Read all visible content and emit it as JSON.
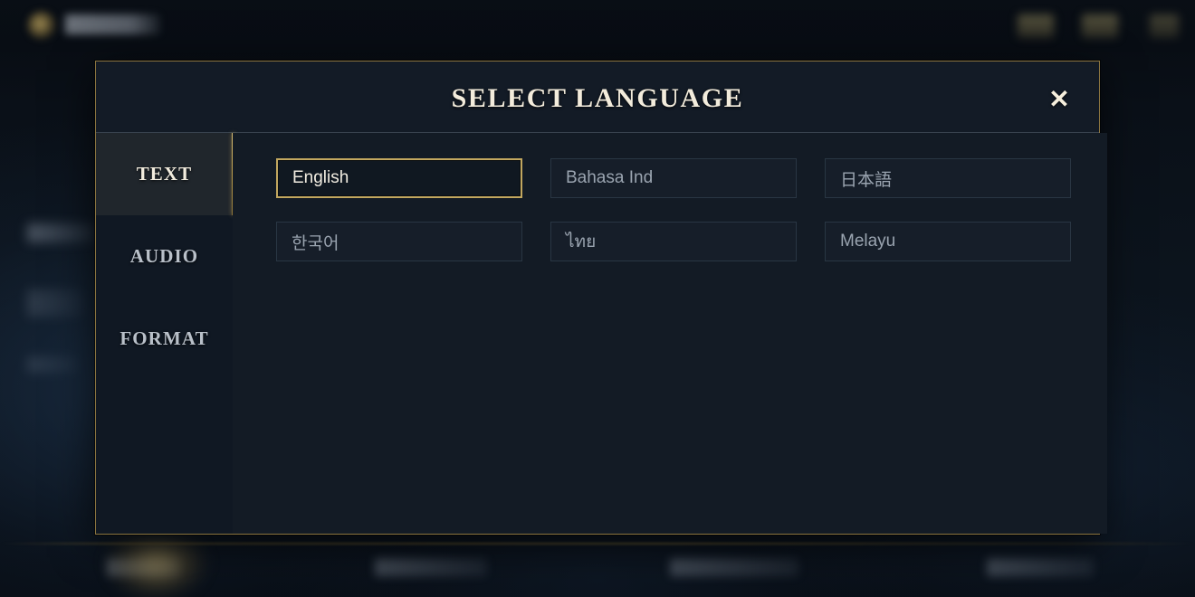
{
  "background": {
    "app_title": "SETTINGS",
    "logo_icon": "game-logo-icon",
    "top_icons": [
      "currency-badge-icon",
      "currency-badge-icon",
      "profile-badge-icon"
    ],
    "bottom_labels": [
      "",
      "",
      "",
      ""
    ]
  },
  "dialog": {
    "title": "SELECT LANGUAGE",
    "close_icon": "✕",
    "close_label": "Close",
    "accent_color": "#c2a75f",
    "panel_color": "#131b25",
    "sidebar_color": "#101823"
  },
  "sidebar": {
    "items": [
      {
        "label": "TEXT",
        "active": true,
        "name": "sidebar-item-text"
      },
      {
        "label": "AUDIO",
        "active": false,
        "name": "sidebar-item-audio"
      },
      {
        "label": "FORMAT",
        "active": false,
        "name": "sidebar-item-format"
      }
    ]
  },
  "languages": {
    "selected": "English",
    "options": [
      {
        "label": "English",
        "selected": true
      },
      {
        "label": "Bahasa Ind",
        "selected": false
      },
      {
        "label": "日本語",
        "selected": false
      },
      {
        "label": "한국어",
        "selected": false
      },
      {
        "label": "ไทย",
        "selected": false
      },
      {
        "label": "Melayu",
        "selected": false
      }
    ]
  }
}
